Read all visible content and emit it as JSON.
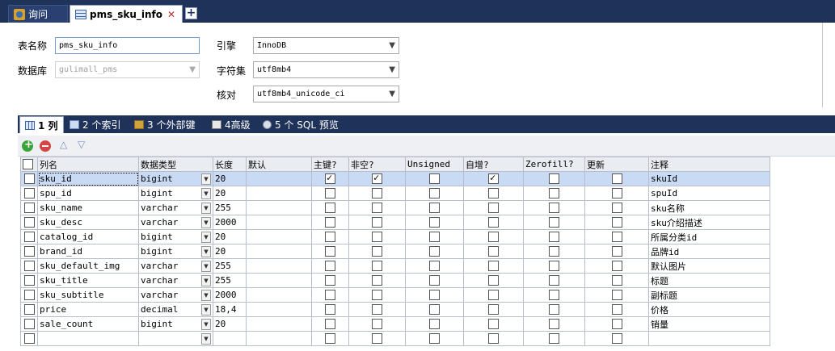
{
  "tabs": {
    "query_label": "询问",
    "table_label": "pms_sku_info",
    "close_glyph": "✕",
    "add_glyph": "+"
  },
  "form": {
    "table_name_label": "表名称",
    "table_name_value": "pms_sku_info",
    "database_label": "数据库",
    "database_value": "gulimall_pms",
    "engine_label": "引擎",
    "engine_value": "InnoDB",
    "charset_label": "字符集",
    "charset_value": "utf8mb4",
    "collation_label": "核对",
    "collation_value": "utf8mb4_unicode_ci"
  },
  "subtabs": {
    "columns": "1 列",
    "indexes": "2 个索引",
    "foreign_keys": "3 个外部键",
    "advanced": "4高级",
    "sql_preview": "5 个 SQL 预览"
  },
  "toolbar": {
    "up_glyph": "△",
    "down_glyph": "▽"
  },
  "grid": {
    "headers": {
      "name": "列名",
      "type": "数据类型",
      "length": "长度",
      "default": "默认",
      "pk": "主键?",
      "notnull": "非空?",
      "unsigned": "Unsigned",
      "autoinc": "自增?",
      "zerofill": "Zerofill?",
      "update": "更新",
      "comment": "注释"
    },
    "rows": [
      {
        "name": "sku_id",
        "type": "bigint",
        "length": "20",
        "default": "",
        "pk": true,
        "notnull": true,
        "unsigned": false,
        "autoinc": true,
        "zerofill": false,
        "update": false,
        "comment": "skuId"
      },
      {
        "name": "spu_id",
        "type": "bigint",
        "length": "20",
        "default": "",
        "pk": false,
        "notnull": false,
        "unsigned": false,
        "autoinc": false,
        "zerofill": false,
        "update": false,
        "comment": "spuId"
      },
      {
        "name": "sku_name",
        "type": "varchar",
        "length": "255",
        "default": "",
        "pk": false,
        "notnull": false,
        "unsigned": false,
        "autoinc": false,
        "zerofill": false,
        "update": false,
        "comment": "sku名称"
      },
      {
        "name": "sku_desc",
        "type": "varchar",
        "length": "2000",
        "default": "",
        "pk": false,
        "notnull": false,
        "unsigned": false,
        "autoinc": false,
        "zerofill": false,
        "update": false,
        "comment": "sku介绍描述"
      },
      {
        "name": "catalog_id",
        "type": "bigint",
        "length": "20",
        "default": "",
        "pk": false,
        "notnull": false,
        "unsigned": false,
        "autoinc": false,
        "zerofill": false,
        "update": false,
        "comment": "所属分类id"
      },
      {
        "name": "brand_id",
        "type": "bigint",
        "length": "20",
        "default": "",
        "pk": false,
        "notnull": false,
        "unsigned": false,
        "autoinc": false,
        "zerofill": false,
        "update": false,
        "comment": "品牌id"
      },
      {
        "name": "sku_default_img",
        "type": "varchar",
        "length": "255",
        "default": "",
        "pk": false,
        "notnull": false,
        "unsigned": false,
        "autoinc": false,
        "zerofill": false,
        "update": false,
        "comment": "默认图片"
      },
      {
        "name": "sku_title",
        "type": "varchar",
        "length": "255",
        "default": "",
        "pk": false,
        "notnull": false,
        "unsigned": false,
        "autoinc": false,
        "zerofill": false,
        "update": false,
        "comment": "标题"
      },
      {
        "name": "sku_subtitle",
        "type": "varchar",
        "length": "2000",
        "default": "",
        "pk": false,
        "notnull": false,
        "unsigned": false,
        "autoinc": false,
        "zerofill": false,
        "update": false,
        "comment": "副标题"
      },
      {
        "name": "price",
        "type": "decimal",
        "length": "18,4",
        "default": "",
        "pk": false,
        "notnull": false,
        "unsigned": false,
        "autoinc": false,
        "zerofill": false,
        "update": false,
        "comment": "价格"
      },
      {
        "name": "sale_count",
        "type": "bigint",
        "length": "20",
        "default": "",
        "pk": false,
        "notnull": false,
        "unsigned": false,
        "autoinc": false,
        "zerofill": false,
        "update": false,
        "comment": "销量"
      },
      {
        "name": "",
        "type": "",
        "length": "",
        "default": "",
        "pk": false,
        "notnull": false,
        "unsigned": false,
        "autoinc": false,
        "zerofill": false,
        "update": false,
        "comment": ""
      }
    ]
  }
}
